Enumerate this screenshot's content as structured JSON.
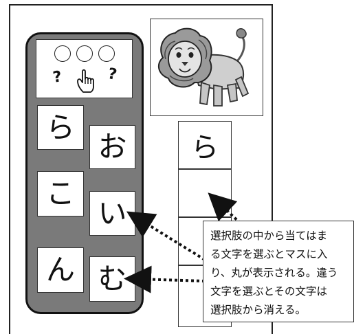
{
  "status": {
    "circles": [
      "○",
      "○",
      "○"
    ],
    "hint_left": "?",
    "hint_right": "?",
    "icons": [
      "empty-circle-icon",
      "question-mark-icon",
      "pointing-hand-icon"
    ]
  },
  "choices": {
    "card_1": "ら",
    "card_2": "お",
    "card_3": "こ",
    "card_4": "い",
    "card_5": "ん",
    "card_6": "む"
  },
  "answer": {
    "cells": [
      "ら",
      "",
      "",
      ""
    ]
  },
  "illustration": {
    "icon": "lion-illustration"
  },
  "callout": {
    "text": "選択肢の中から当てはま\nる文字を選ぶとマスに入\nり、丸が表示される。違う\n文字を選ぶとその文字は\n選択肢から消える。"
  },
  "colors": {
    "panel": "#7a7a7a",
    "border": "#111111",
    "background": "#ffffff"
  }
}
